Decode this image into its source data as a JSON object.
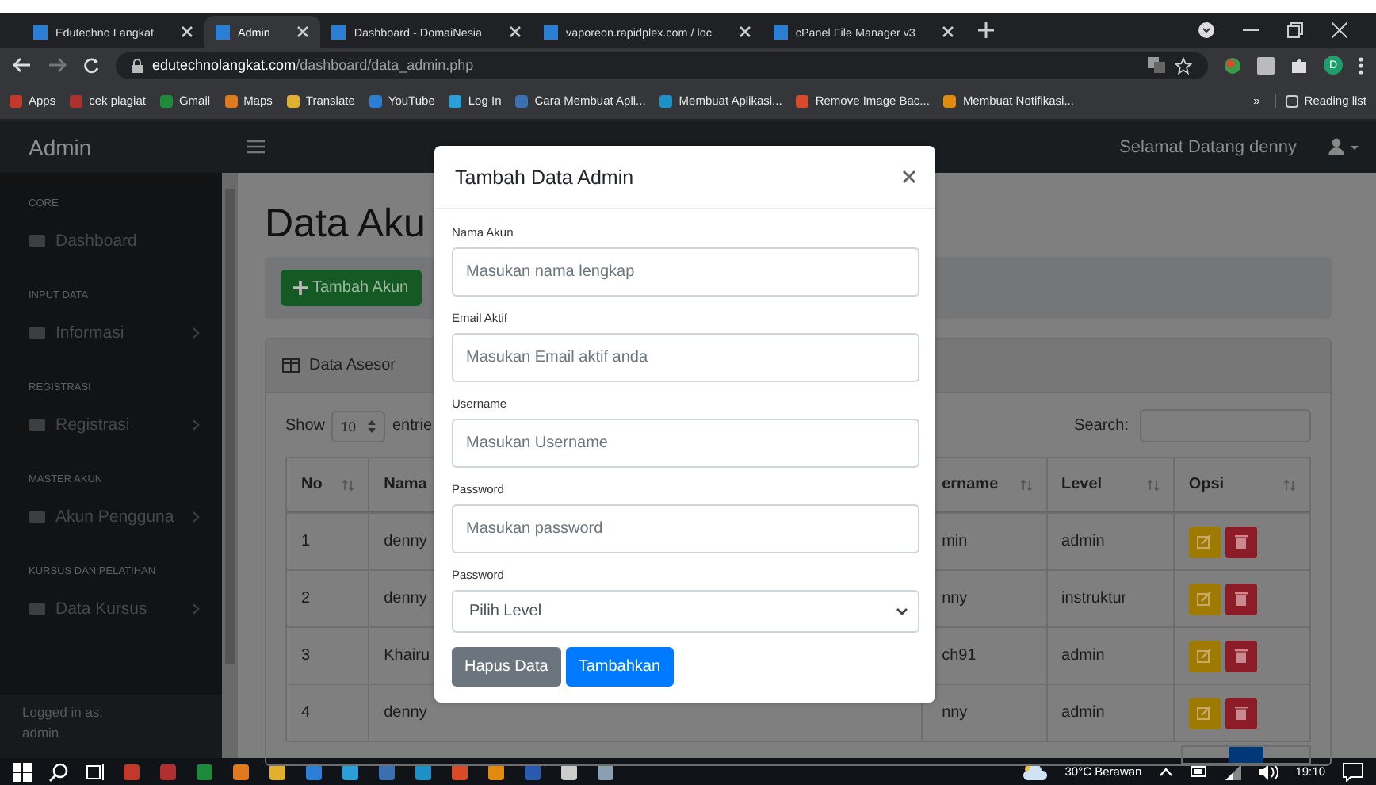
{
  "browser": {
    "tabs": [
      {
        "title": "Edutechno Langkat",
        "selected": false
      },
      {
        "title": "Admin",
        "selected": true
      },
      {
        "title": "Dashboard - DomaiNesia",
        "selected": false
      },
      {
        "title": "vaporeon.rapidplex.com / loc",
        "selected": false
      },
      {
        "title": "cPanel File Manager v3",
        "selected": false
      }
    ],
    "address": {
      "host": "edutechnolangkat.com",
      "path": "/dashboard/data_admin.php"
    },
    "bookmarks": [
      "Apps",
      "cek plagiat",
      "Gmail",
      "Maps",
      "Translate",
      "YouTube",
      "Log In",
      "Cara Membuat Apli...",
      "Membuat Aplikasi...",
      "Remove Image Bac...",
      "Membuat Notifikasi..."
    ],
    "bookmarks_overflow": "»",
    "reading_list": "Reading list",
    "profile_initial": "D"
  },
  "app": {
    "brand": "Admin",
    "greeting": "Selamat Datang denny",
    "sidebar": {
      "sections": [
        {
          "heading": "CORE",
          "items": [
            {
              "label": "Dashboard",
              "expandable": false
            }
          ]
        },
        {
          "heading": "INPUT DATA",
          "items": [
            {
              "label": "Informasi",
              "expandable": true
            }
          ]
        },
        {
          "heading": "REGISTRASI",
          "items": [
            {
              "label": "Registrasi",
              "expandable": true
            }
          ]
        },
        {
          "heading": "MASTER AKUN",
          "items": [
            {
              "label": "Akun Pengguna",
              "expandable": true
            }
          ]
        },
        {
          "heading": "KURSUS DAN PELATIHAN",
          "items": [
            {
              "label": "Data Kursus",
              "expandable": true
            }
          ]
        }
      ],
      "footer_label": "Logged in as:",
      "footer_user": "admin"
    },
    "page_title": "Data Aku",
    "add_button": "Tambah Akun",
    "card_title": "Data Asesor",
    "show_label": "Show",
    "page_size": "10",
    "entries_label": "entrie",
    "search_label": "Search:",
    "table": {
      "columns": [
        {
          "label": "No",
          "sort_icon": true
        },
        {
          "label": "Nama",
          "sort_icon": false
        },
        {
          "label": "ername",
          "sort_icon": true
        },
        {
          "label": "Level",
          "sort_icon": true
        },
        {
          "label": "Opsi",
          "sort_icon": true
        }
      ],
      "rows": [
        {
          "no": "1",
          "name": "denny",
          "username": "min",
          "level": "admin"
        },
        {
          "no": "2",
          "name": "denny",
          "username": "nny",
          "level": "instruktur"
        },
        {
          "no": "3",
          "name": "Khairu",
          "username": "ch91",
          "level": "admin"
        },
        {
          "no": "4",
          "name": "denny",
          "username": "nny",
          "level": "admin"
        }
      ]
    }
  },
  "modal": {
    "title": "Tambah Data Admin",
    "fields": [
      {
        "label": "Nama Akun",
        "placeholder": "Masukan nama lengkap",
        "kind": "input"
      },
      {
        "label": "Email Aktif",
        "placeholder": "Masukan Email aktif anda",
        "kind": "input"
      },
      {
        "label": "Username",
        "placeholder": "Masukan Username",
        "kind": "input"
      },
      {
        "label": "Password",
        "placeholder": "Masukan password",
        "kind": "input"
      },
      {
        "label": "Password",
        "placeholder": "Pilih Level",
        "kind": "select"
      }
    ],
    "buttons": [
      {
        "label": "Hapus Data",
        "kind": "secondary"
      },
      {
        "label": "Tambahkan",
        "kind": "primary"
      }
    ]
  },
  "taskbar": {
    "weather": "30°C Berawan",
    "time": "19:10"
  }
}
